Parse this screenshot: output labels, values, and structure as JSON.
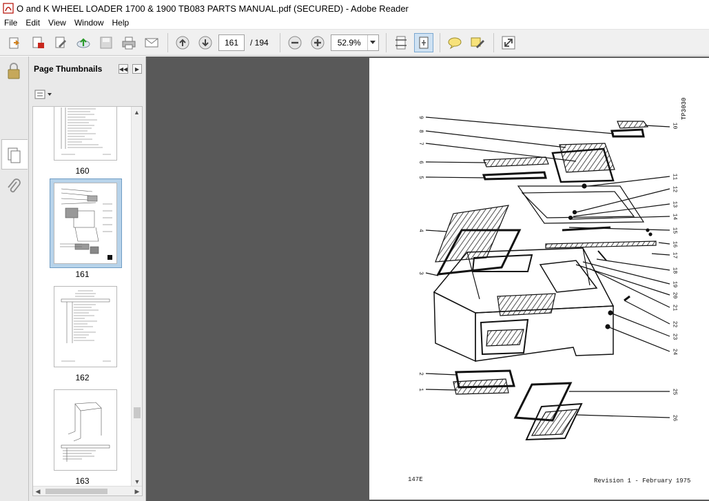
{
  "window": {
    "title": "O and K WHEEL LOADER 1700 & 1900 TB083 PARTS MANUAL.pdf (SECURED) - Adobe Reader"
  },
  "menu": [
    "File",
    "Edit",
    "View",
    "Window",
    "Help"
  ],
  "toolbar": {
    "current_page": "161",
    "total_pages": "/ 194",
    "zoom": "52.9%",
    "buttons": [
      "open-icon",
      "create-pdf-icon",
      "edit-icon",
      "upload-icon",
      "save-icon",
      "print-icon",
      "email-icon",
      "page-up-icon",
      "page-down-icon",
      "zoom-out-icon",
      "zoom-in-icon",
      "fit-page-icon",
      "fit-width-icon",
      "comment-icon",
      "sign-icon",
      "expand-icon"
    ]
  },
  "sidebar": {
    "title": "Page Thumbnails",
    "thumbnails": [
      {
        "label": "160",
        "selected": false
      },
      {
        "label": "161",
        "selected": true
      },
      {
        "label": "162",
        "selected": false
      },
      {
        "label": "163",
        "selected": false
      }
    ]
  },
  "document": {
    "side_code": "TP3030",
    "footer_left": "147E",
    "footer_right": "Revision 1 - February 1975",
    "callouts_left": [
      "9",
      "8",
      "7",
      "6",
      "5",
      "4",
      "3",
      "2",
      "1"
    ],
    "callouts_right": [
      "10",
      "11",
      "12",
      "13",
      "14",
      "15",
      "16",
      "17",
      "18",
      "19",
      "20",
      "21",
      "22",
      "23",
      "24",
      "25",
      "26"
    ]
  },
  "colors": {
    "doc_bg": "#595959",
    "sidebar_bg": "#e9e9e9",
    "selection": "#b7d3ea"
  }
}
